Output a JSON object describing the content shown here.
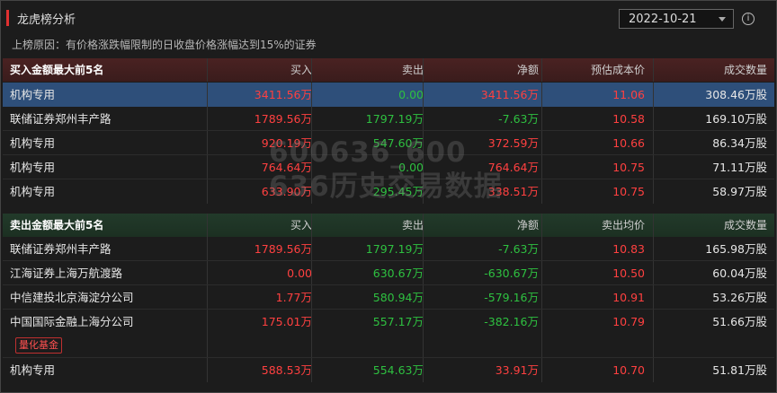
{
  "panel": {
    "title": "龙虎榜分析",
    "date": "2022-10-21",
    "info_icon": "ⓘ"
  },
  "reason": "上榜原因：有价格涨跌幅限制的日收盘价格涨幅达到15%的证券",
  "buy": {
    "headers": [
      "买入金额最大前5名",
      "买入",
      "卖出",
      "净额",
      "预估成本价",
      "成交数量"
    ],
    "rows": [
      [
        "机构专用",
        "3411.56万",
        "0.00",
        "3411.56万",
        "11.06",
        "308.46万股"
      ],
      [
        "联储证券郑州丰产路",
        "1789.56万",
        "1797.19万",
        "-7.63万",
        "10.58",
        "169.10万股"
      ],
      [
        "机构专用",
        "920.19万",
        "547.60万",
        "372.59万",
        "10.66",
        "86.34万股"
      ],
      [
        "机构专用",
        "764.64万",
        "0.00",
        "764.64万",
        "10.75",
        "71.11万股"
      ],
      [
        "机构专用",
        "633.90万",
        "295.45万",
        "338.51万",
        "10.75",
        "58.97万股"
      ]
    ]
  },
  "sell": {
    "headers": [
      "卖出金额最大前5名",
      "买入",
      "卖出",
      "净额",
      "卖出均价",
      "成交数量"
    ],
    "rows": [
      [
        "联储证券郑州丰产路",
        "1789.56万",
        "1797.19万",
        "-7.63万",
        "10.83",
        "165.98万股"
      ],
      [
        "江海证券上海万航渡路",
        "0.00",
        "630.67万",
        "-630.67万",
        "10.50",
        "60.04万股"
      ],
      [
        "中信建投北京海淀分公司",
        "1.77万",
        "580.94万",
        "-579.16万",
        "10.91",
        "53.26万股"
      ],
      [
        "中国国际金融上海分公司",
        "175.01万",
        "557.17万",
        "-382.16万",
        "10.79",
        "51.66万股"
      ],
      [
        "机构专用",
        "588.53万",
        "554.63万",
        "33.91万",
        "10.70",
        "51.81万股"
      ]
    ],
    "badge": "量化基金"
  },
  "watermark": {
    "line1": "600636_600",
    "line2": "636历史交易数据"
  },
  "colors": {
    "up": "#ff4040",
    "down": "#2ec040",
    "accent": "#e03030",
    "highlight": "#2e4f7a"
  }
}
